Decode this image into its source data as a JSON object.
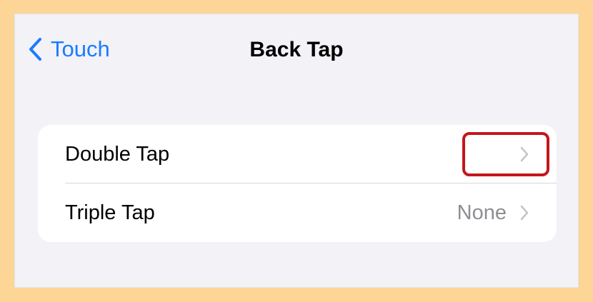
{
  "nav": {
    "back_label": "Touch",
    "title": "Back Tap"
  },
  "rows": [
    {
      "label": "Double Tap",
      "value": "",
      "accessory": "chevron-right-icon"
    },
    {
      "label": "Triple Tap",
      "value": "None",
      "accessory": "chevron-right-icon"
    }
  ],
  "colors": {
    "outer_background": "#fdd596",
    "screen_background": "#f2f2f7",
    "accent": "#1b7bff",
    "secondary_text": "#8e8e93",
    "highlight_border": "#c4161c"
  },
  "icons": {
    "back": "chevron-left-icon",
    "row_accessory": "chevron-right-icon"
  }
}
